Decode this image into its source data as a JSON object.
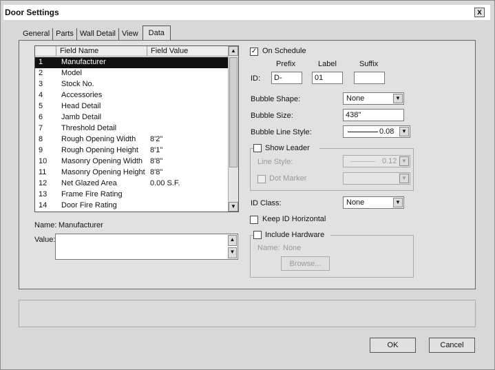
{
  "window": {
    "title": "Door Settings",
    "close_label": "x"
  },
  "tabs": [
    {
      "label": "General"
    },
    {
      "label": "Parts"
    },
    {
      "label": "Wall Detail"
    },
    {
      "label": "View"
    },
    {
      "label": "Data"
    }
  ],
  "field_list": {
    "headers": {
      "name": "Field Name",
      "value": "Field Value"
    },
    "rows": [
      {
        "num": "1",
        "name": "Manufacturer",
        "value": ""
      },
      {
        "num": "2",
        "name": "Model",
        "value": ""
      },
      {
        "num": "3",
        "name": "Stock No.",
        "value": ""
      },
      {
        "num": "4",
        "name": "Accessories",
        "value": ""
      },
      {
        "num": "5",
        "name": "Head Detail",
        "value": ""
      },
      {
        "num": "6",
        "name": "Jamb Detail",
        "value": ""
      },
      {
        "num": "7",
        "name": "Threshold Detail",
        "value": ""
      },
      {
        "num": "8",
        "name": "Rough Opening Width",
        "value": "8'2\""
      },
      {
        "num": "9",
        "name": "Rough Opening Height",
        "value": "8'1\""
      },
      {
        "num": "10",
        "name": "Masonry Opening Width",
        "value": "8'8\""
      },
      {
        "num": "11",
        "name": "Masonry Opening Height",
        "value": "8'8\""
      },
      {
        "num": "12",
        "name": "Net Glazed Area",
        "value": "0.00 S.F."
      },
      {
        "num": "13",
        "name": "Frame Fire Rating",
        "value": ""
      },
      {
        "num": "14",
        "name": "Door Fire Rating",
        "value": ""
      }
    ],
    "selected_index": 0
  },
  "name_field": {
    "label": "Name:",
    "value": "Manufacturer"
  },
  "value_field": {
    "label": "Value:",
    "value": ""
  },
  "on_schedule": {
    "label": "On Schedule",
    "checked": true,
    "mark": "✓"
  },
  "id": {
    "label": "ID:",
    "prefix_label": "Prefix",
    "prefix": "D-",
    "label_label": "Label",
    "label_value": "01",
    "suffix_label": "Suffix",
    "suffix": ""
  },
  "bubble_shape": {
    "label": "Bubble Shape:",
    "value": "None"
  },
  "bubble_size": {
    "label": "Bubble Size:",
    "value": "438\""
  },
  "bubble_line_style": {
    "label": "Bubble Line Style:",
    "value": "0.08"
  },
  "show_leader": {
    "label": "Show Leader",
    "line_style_label": "Line Style:",
    "line_style_value": "0.12",
    "dot_marker_label": "Dot Marker"
  },
  "id_class": {
    "label": "ID Class:",
    "value": "None"
  },
  "keep_id_horizontal": {
    "label": "Keep ID Horizontal"
  },
  "include_hardware": {
    "label": "Include Hardware",
    "name_label": "Name:",
    "name_value": "None",
    "browse_label": "Browse..."
  },
  "buttons": {
    "ok": "OK",
    "cancel": "Cancel"
  }
}
